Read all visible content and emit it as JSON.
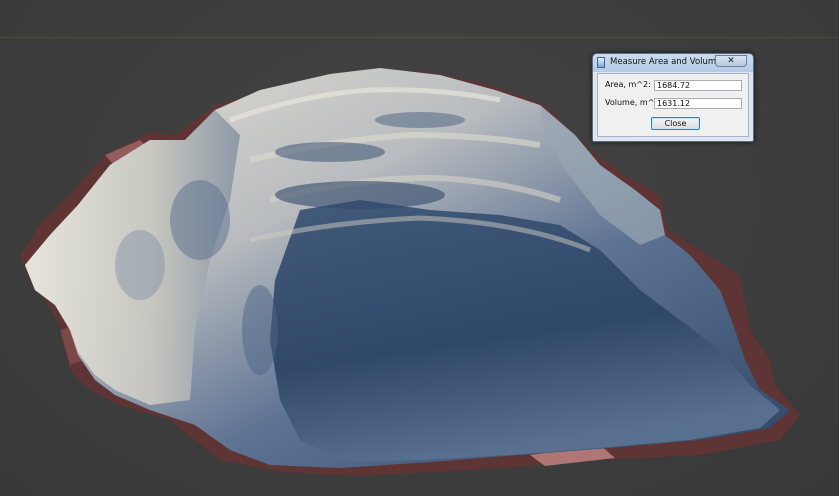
{
  "dialog": {
    "title": "Measure Area and Volume",
    "close_glyph": "✕",
    "area_label": "Area, m^2:",
    "area_value": "1684.72",
    "volume_label": "Volume, m^3:",
    "volume_value": "1631.12",
    "close_button_label": "Close"
  },
  "icons": {
    "window_close": "close-icon",
    "app": "app-icon"
  },
  "colors": {
    "background": "#3f3f3f",
    "terrain_shadow": "#2f4766",
    "terrain_light": "#d9d6cc",
    "terrain_base": "#6a3838"
  }
}
